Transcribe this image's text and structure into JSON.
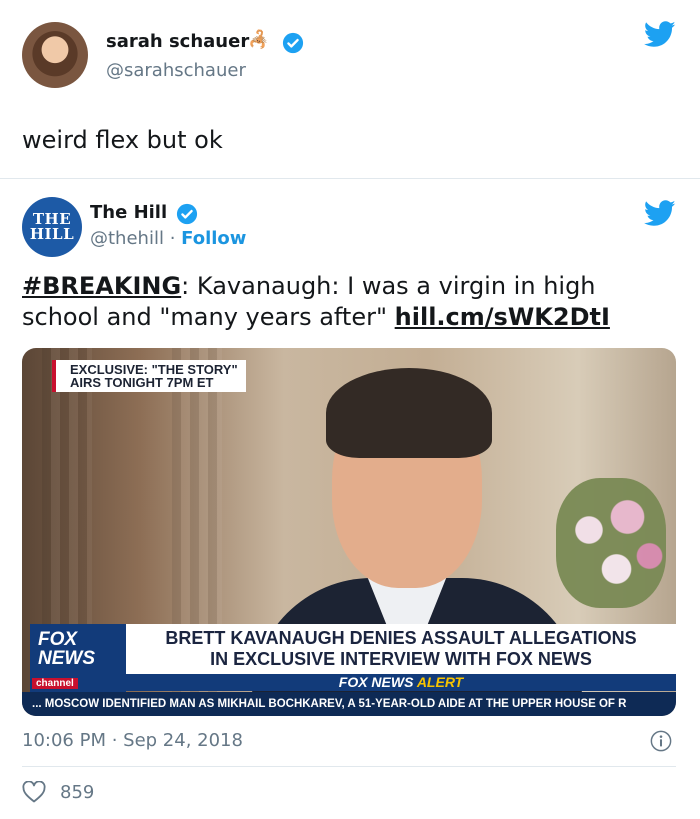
{
  "outer_tweet": {
    "name": "sarah schauer",
    "handle": "@sarahschauer",
    "text": "weird flex but ok"
  },
  "quoted_tweet": {
    "avatar_text_line1": "THE",
    "avatar_text_line2": "HILL",
    "name": "The Hill",
    "handle": "@thehill",
    "separator": "·",
    "follow_label": "Follow",
    "hashtag": "#BREAKING",
    "body_text": ": Kavanaugh: I was a virgin in high school and \"many years after\" ",
    "link": "hill.cm/sWK2DtI",
    "media": {
      "exclusive_line1": "EXCLUSIVE: \"THE STORY\"",
      "exclusive_line2": "AIRS TONIGHT 7PM ET",
      "fox_logo_line1": "FOX",
      "fox_logo_line2": "NEWS",
      "fox_channel": "channel",
      "headline_line1": "BRETT KAVANAUGH DENIES ASSAULT ALLEGATIONS",
      "headline_line2": "IN EXCLUSIVE INTERVIEW WITH FOX NEWS",
      "alert_brand": "FOX NEWS",
      "alert_word": "ALERT",
      "ticker": "... MOSCOW IDENTIFIED MAN AS MIKHAIL BOCHKAREV, A 51-YEAR-OLD AIDE AT THE UPPER HOUSE OF R"
    },
    "timestamp": "10:06 PM · Sep 24, 2018",
    "likes": "859"
  },
  "colors": {
    "twitter_blue": "#1da1f2",
    "link_blue": "#1b95e0",
    "muted": "#657786",
    "fox_blue": "#123b7a",
    "fox_red": "#c8102e",
    "alert_yellow": "#f7c300"
  },
  "icons": {
    "twitter": "twitter-bird-icon",
    "verified": "verified-badge-icon",
    "info": "info-icon",
    "heart": "heart-icon",
    "emoji": "scorpion-emoji"
  }
}
